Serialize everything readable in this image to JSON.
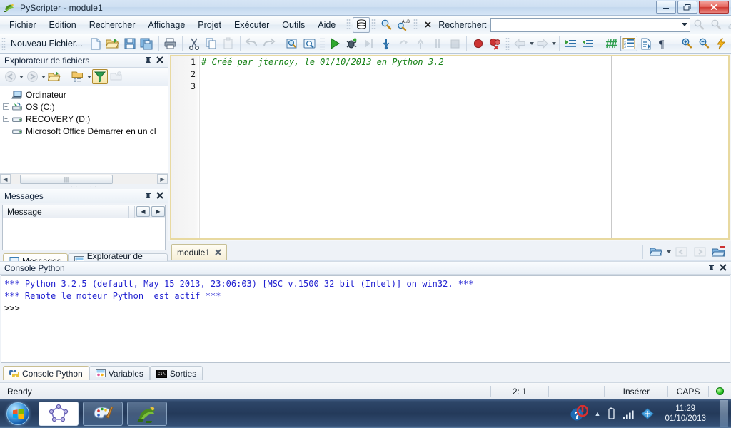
{
  "window": {
    "title": "PyScripter - module1",
    "controls": {
      "minimize": "—",
      "maximize": "❐",
      "close": "✕"
    }
  },
  "menubar": {
    "items": [
      {
        "label": "Fichier"
      },
      {
        "label": "Edition"
      },
      {
        "label": "Rechercher"
      },
      {
        "label": "Affichage"
      },
      {
        "label": "Projet"
      },
      {
        "label": "Exécuter"
      },
      {
        "label": "Outils"
      },
      {
        "label": "Aide"
      }
    ],
    "find": {
      "label": "Rechercher:",
      "value": "",
      "placeholder": ""
    }
  },
  "toolbar2": {
    "new_file_label": "Nouveau Fichier..."
  },
  "file_explorer": {
    "title": "Explorateur de fichiers",
    "pin": "⊞",
    "close": "✕",
    "tree": [
      {
        "label": "Ordinateur",
        "icon": "computer-icon",
        "expander": "",
        "indent": 0
      },
      {
        "label": "OS (C:)",
        "icon": "harddisk-icon",
        "expander": "+",
        "indent": 1
      },
      {
        "label": "RECOVERY (D:)",
        "icon": "drive-icon",
        "expander": "+",
        "indent": 1
      },
      {
        "label": "Microsoft Office Démarrer en un cl",
        "icon": "drive-icon",
        "expander": "",
        "indent": 1
      }
    ]
  },
  "messages_panel": {
    "title": "Messages",
    "pin": "⊞",
    "close": "✕",
    "column_header": "Message",
    "rows": []
  },
  "dock_tabs": [
    {
      "label": "Messages",
      "icon": "messages-icon",
      "active": true
    },
    {
      "label": "Explorateur de Code",
      "icon": "code-explorer-icon",
      "active": false
    }
  ],
  "editor": {
    "line_numbers": [
      "1",
      "2",
      "3"
    ],
    "lines": [
      "# Créé par jternoy, le 01/10/2013 en Python 3.2",
      "",
      ""
    ],
    "comment_color": "#178217",
    "tabs": [
      {
        "label": "module1",
        "close": "✕",
        "active": true
      }
    ]
  },
  "console": {
    "title": "Console Python",
    "pin": "⊞",
    "close": "✕",
    "lines": [
      {
        "text": "*** Python 3.2.5 (default, May 15 2013, 23:06:03) [MSC v.1500 32 bit (Intel)] on win32. ***",
        "style": "blue"
      },
      {
        "text": "*** Remote le moteur Python  est actif ***",
        "style": "blue"
      },
      {
        "text": ">>>",
        "style": "prompt"
      }
    ],
    "text_color": "#2020d0",
    "tabs": [
      {
        "label": "Console Python",
        "icon": "python-icon",
        "active": true
      },
      {
        "label": "Variables",
        "icon": "variables-icon",
        "active": false
      },
      {
        "label": "Sorties",
        "icon": "output-icon",
        "active": false
      }
    ]
  },
  "statusbar": {
    "state": "Ready",
    "cursor": "2: 1",
    "blank": "",
    "insert_mode": "Insérer",
    "caps": "CAPS",
    "indicator_color": "#22c022"
  },
  "taskbar": {
    "start": "start-orb",
    "items": [
      {
        "name": "geogebra-icon"
      },
      {
        "name": "paint-icon"
      },
      {
        "name": "pyscripter-icon"
      }
    ],
    "tray": {
      "expand": "▲",
      "items": [
        "battery-icon",
        "network-signal-icon",
        "wireless-icon"
      ],
      "time": "11:29",
      "date": "01/10/2013"
    }
  }
}
